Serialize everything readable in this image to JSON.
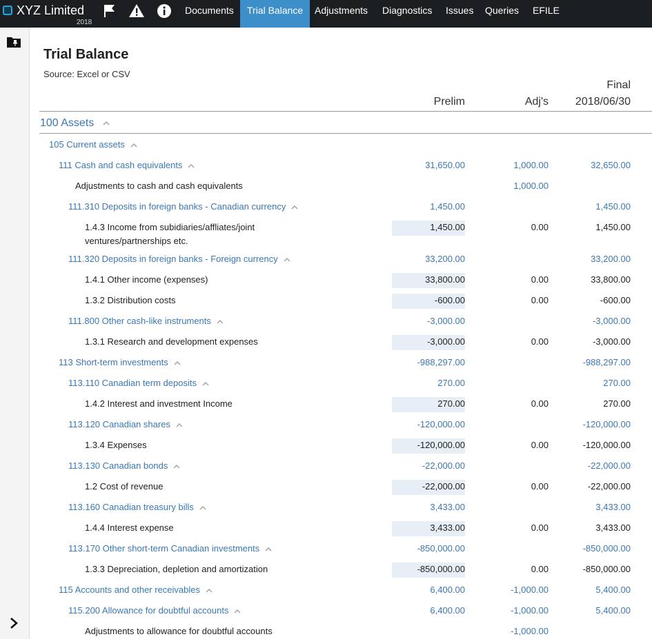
{
  "app": {
    "title": "XYZ Limited",
    "year": "2018"
  },
  "nav": [
    "Documents",
    "Trial Balance",
    "Adjustments",
    "Diagnostics",
    "Issues",
    "Queries",
    "EFILE"
  ],
  "page": {
    "title": "Trial Balance",
    "source": "Source: Excel or CSV",
    "col_prelim": "Prelim",
    "col_adj": "Adj's",
    "col_final_top": "Final",
    "col_final_date": "2018/06/30"
  },
  "section": {
    "label": "100 Assets"
  },
  "rows": [
    {
      "label": "105 Current assets",
      "prelim": "",
      "adj": "",
      "final": ""
    },
    {
      "label": "111 Cash and cash equivalents",
      "prelim": "31,650.00",
      "adj": "1,000.00",
      "final": "32,650.00"
    },
    {
      "label": "Adjustments to cash and cash equivalents",
      "prelim": "",
      "adj": "1,000.00",
      "final": ""
    },
    {
      "label": "111.310 Deposits in foreign banks - Canadian currency",
      "prelim": "1,450.00",
      "adj": "",
      "final": "1,450.00"
    },
    {
      "label": "1.4.3 Income from subidiaries/affliates/joint",
      "label2": "ventures/partnerships etc.",
      "prelim": "1,450.00",
      "adj": "0.00",
      "final": "1,450.00"
    },
    {
      "label": "111.320 Deposits in foreign banks - Foreign currency",
      "prelim": "33,200.00",
      "adj": "",
      "final": "33,200.00"
    },
    {
      "label": "1.4.1 Other income (expenses)",
      "prelim": "33,800.00",
      "adj": "0.00",
      "final": "33,800.00"
    },
    {
      "label": "1.3.2 Distribution costs",
      "prelim": "-600.00",
      "adj": "0.00",
      "final": "-600.00"
    },
    {
      "label": "111.800 Other cash-like instruments",
      "prelim": "-3,000.00",
      "adj": "",
      "final": "-3,000.00"
    },
    {
      "label": "1.3.1 Research and development expenses",
      "prelim": "-3,000.00",
      "adj": "0.00",
      "final": "-3,000.00"
    },
    {
      "label": "113 Short-term investments",
      "prelim": "-988,297.00",
      "adj": "",
      "final": "-988,297.00"
    },
    {
      "label": "113.110 Canadian term deposits",
      "prelim": "270.00",
      "adj": "",
      "final": "270.00"
    },
    {
      "label": "1.4.2 Interest and investment Income",
      "prelim": "270.00",
      "adj": "0.00",
      "final": "270.00"
    },
    {
      "label": "113.120 Canadian shares",
      "prelim": "-120,000.00",
      "adj": "",
      "final": "-120,000.00"
    },
    {
      "label": "1.3.4 Expenses",
      "prelim": "-120,000.00",
      "adj": "0.00",
      "final": "-120,000.00"
    },
    {
      "label": "113.130 Canadian bonds",
      "prelim": "-22,000.00",
      "adj": "",
      "final": "-22,000.00"
    },
    {
      "label": "1.2 Cost of revenue",
      "prelim": "-22,000.00",
      "adj": "0.00",
      "final": "-22,000.00"
    },
    {
      "label": "113.160 Canadian treasury bills",
      "prelim": "3,433.00",
      "adj": "",
      "final": "3,433.00"
    },
    {
      "label": "1.4.4 Interest expense",
      "prelim": "3,433.00",
      "adj": "0.00",
      "final": "3,433.00"
    },
    {
      "label": "113.170 Other short-term Canadian investments",
      "prelim": "-850,000.00",
      "adj": "",
      "final": "-850,000.00"
    },
    {
      "label": "1.3.3 Depreciation, depletion and amortization",
      "prelim": "-850,000.00",
      "adj": "0.00",
      "final": "-850,000.00"
    },
    {
      "label": "115 Accounts and other receivables",
      "prelim": "6,400.00",
      "adj": "-1,000.00",
      "final": "5,400.00"
    },
    {
      "label": "115.200 Allowance for doubtful accounts",
      "prelim": "6,400.00",
      "adj": "-1,000.00",
      "final": "5,400.00"
    },
    {
      "label": "Adjustments to allowance for doubtful accounts",
      "prelim": "",
      "adj": "-1,000.00",
      "final": ""
    }
  ],
  "colors": {
    "topbar": "#1c1f22",
    "active_tab": "#3d8fc9",
    "link": "#3a78b5",
    "shade": "#e7eef6"
  },
  "icons": [
    "flag-icon",
    "warning-icon",
    "info-icon",
    "folder-pin-icon",
    "chevron-up-icon",
    "chevron-right-icon"
  ]
}
